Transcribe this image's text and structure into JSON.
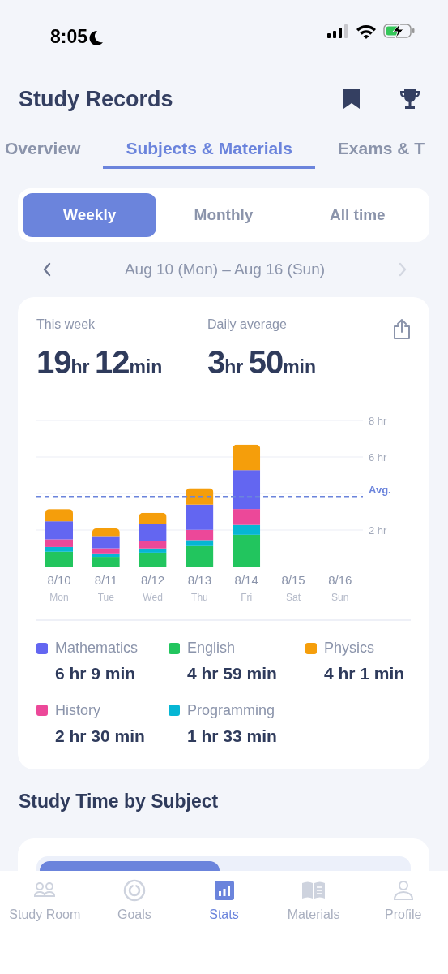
{
  "status_bar": {
    "time": "8:05",
    "focus_mode": true
  },
  "header": {
    "title": "Study Records"
  },
  "tabs": [
    {
      "label": "Overview",
      "selected": false
    },
    {
      "label": "Subjects & Materials",
      "selected": true
    },
    {
      "label": "Exams & T",
      "selected": false
    }
  ],
  "period": [
    {
      "label": "Weekly",
      "selected": true
    },
    {
      "label": "Monthly",
      "selected": false
    },
    {
      "label": "All time",
      "selected": false
    }
  ],
  "date_nav": {
    "range": "Aug 10 (Mon) – Aug 16 (Sun)",
    "prev_disabled": false,
    "next_disabled": true
  },
  "summary": [
    {
      "label": "This week",
      "value": [
        {
          "num": "19",
          "unit": "hr"
        },
        {
          "num": "12",
          "unit": "min"
        }
      ]
    },
    {
      "label": "Daily average",
      "value": [
        {
          "num": "3",
          "unit": "hr"
        },
        {
          "num": "50",
          "unit": "min"
        }
      ]
    }
  ],
  "chart": {
    "chart_data": {
      "type": "bar",
      "stacked": true,
      "categories": [
        "8/10",
        "8/11",
        "8/12",
        "8/13",
        "8/14",
        "8/15",
        "8/16"
      ],
      "series": [
        {
          "name": "English",
          "color": "#22c55e",
          "values": [
            0.81,
            0.53,
            0.76,
            1.12,
            1.74,
            null,
            null
          ]
        },
        {
          "name": "Programming",
          "color": "#06b6d4",
          "values": [
            0.26,
            0.19,
            0.23,
            0.33,
            0.54,
            null,
            null
          ]
        },
        {
          "name": "History",
          "color": "#ec4899",
          "values": [
            0.42,
            0.28,
            0.39,
            0.56,
            0.87,
            null,
            null
          ]
        },
        {
          "name": "Mathematics",
          "color": "#6366f1",
          "values": [
            0.99,
            0.67,
            0.95,
            1.38,
            2.13,
            null,
            null
          ]
        },
        {
          "name": "Physics",
          "color": "#f59e0b",
          "values": [
            0.67,
            0.42,
            0.61,
            0.9,
            1.4,
            null,
            null
          ]
        }
      ],
      "ylim": [
        0,
        8
      ],
      "yticks": [
        {
          "value": 2,
          "label": "2 hr"
        },
        {
          "value": 6,
          "label": "6 hr"
        },
        {
          "value": 8,
          "label": "8 hr"
        }
      ],
      "ref_lines": [
        {
          "axis": "y",
          "value": 3.83,
          "label": "Avg.",
          "color": "#6b84dc"
        }
      ]
    },
    "weekdays": [
      "Mon",
      "Tue",
      "Wed",
      "Thu",
      "Fri",
      "Sat",
      "Sun"
    ]
  },
  "legend_times": [
    "6 hr 9 min",
    "4 hr 59 min",
    "4 hr 1 min",
    "2 hr 30 min",
    "1 hr 33 min"
  ],
  "subject_section": {
    "title": "Study Time by Subject",
    "bars": [
      {
        "level": 0.49
      }
    ]
  },
  "bottom_nav": [
    {
      "label": "Study Room",
      "selected": false
    },
    {
      "label": "Goals",
      "selected": false
    },
    {
      "label": "Stats",
      "selected": true
    },
    {
      "label": "Materials",
      "selected": false
    },
    {
      "label": "Profile",
      "selected": false
    }
  ]
}
